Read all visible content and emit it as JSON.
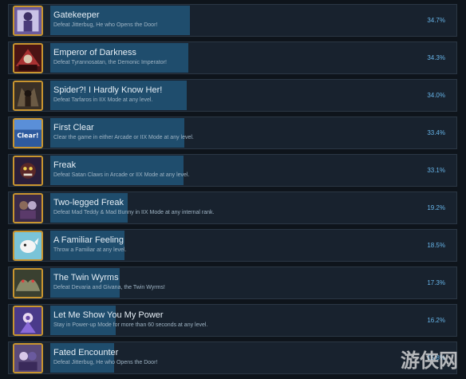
{
  "watermark": "游侠网",
  "achievements": [
    {
      "title": "Gatekeeper",
      "description": "Defeat Jitterbug, He who Opens the Door!",
      "percent_label": "34.7%",
      "percent": 34.7,
      "icon": "gatekeeper-icon"
    },
    {
      "title": "Emperor of Darkness",
      "description": "Defeat Tyrannosatan, the Demonic Imperator!",
      "percent_label": "34.3%",
      "percent": 34.3,
      "icon": "emperor-icon"
    },
    {
      "title": "Spider?! I Hardly Know Her!",
      "description": "Defeat Tarfaros in IIX Mode at any level.",
      "percent_label": "34.0%",
      "percent": 34.0,
      "icon": "spider-icon"
    },
    {
      "title": "First Clear",
      "description": "Clear the game in either Arcade or IIX Mode at any level.",
      "percent_label": "33.4%",
      "percent": 33.4,
      "icon": "clear-icon",
      "icon_text": "Clear!"
    },
    {
      "title": "Freak",
      "description": "Defeat Satan Claws in Arcade or IIX Mode at any level.",
      "percent_label": "33.1%",
      "percent": 33.1,
      "icon": "freak-icon"
    },
    {
      "title": "Two-legged Freak",
      "description": "Defeat Mad Teddy & Mad Bunny in IIX Mode at any internal rank.",
      "percent_label": "19.2%",
      "percent": 19.2,
      "icon": "two-legged-freak-icon"
    },
    {
      "title": "A Familiar Feeling",
      "description": "Throw a Familiar at any level.",
      "percent_label": "18.5%",
      "percent": 18.5,
      "icon": "familiar-icon"
    },
    {
      "title": "The Twin Wyrms",
      "description": "Defeat Devaria and Givana, the Twin Wyrms!",
      "percent_label": "17.3%",
      "percent": 17.3,
      "icon": "twin-wyrms-icon"
    },
    {
      "title": "Let Me Show You My Power",
      "description": "Stay in Power-up Mode for more than 60 seconds at any level.",
      "percent_label": "16.2%",
      "percent": 16.2,
      "icon": "power-icon"
    },
    {
      "title": "Fated Encounter",
      "description": "Defeat Jitterbug, He who Opens the Door!",
      "percent_label": "15.8%",
      "percent": 15.8,
      "icon": "fated-encounter-icon"
    }
  ]
}
